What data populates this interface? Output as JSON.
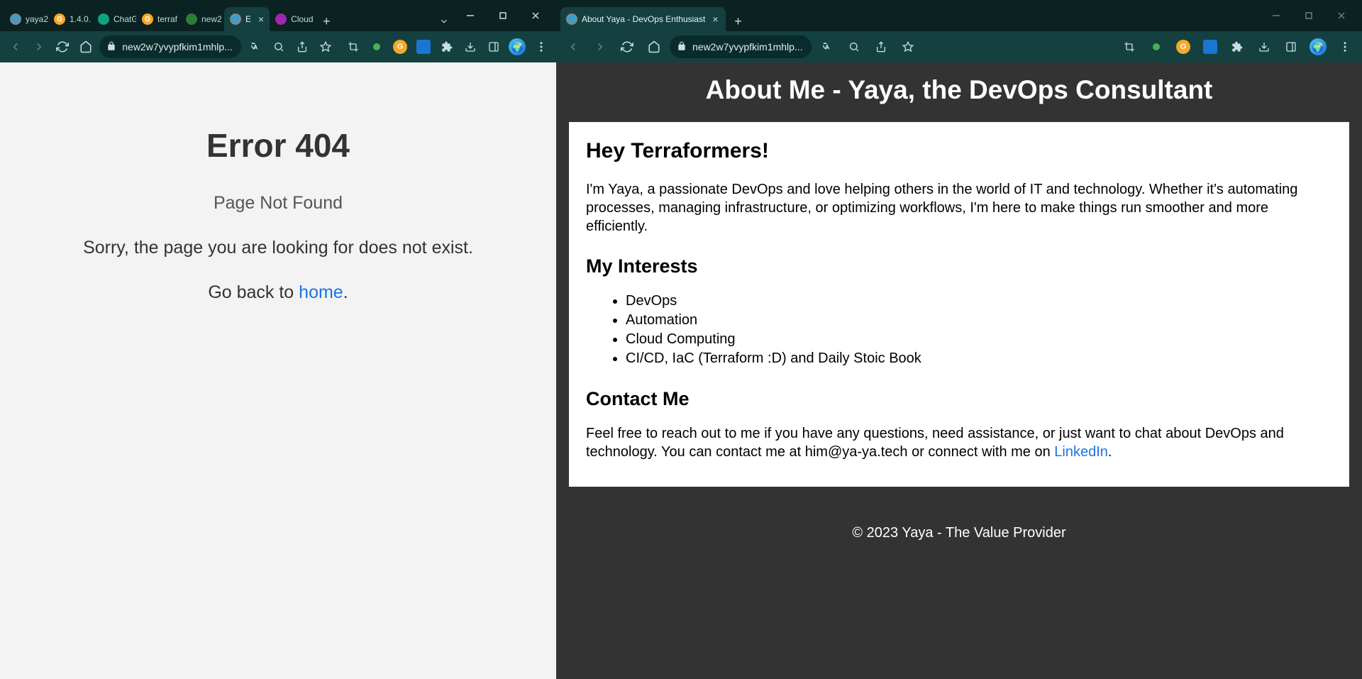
{
  "left": {
    "tabs": [
      {
        "label": "yaya2"
      },
      {
        "label": "1.4.0."
      },
      {
        "label": "ChatG"
      },
      {
        "label": "terraf"
      },
      {
        "label": "new2"
      },
      {
        "label": "E",
        "active": true
      },
      {
        "label": "Cloud"
      }
    ],
    "url": "new2w7yvypfkim1mhlp...",
    "page": {
      "title": "Error 404",
      "subtitle": "Page Not Found",
      "message": "Sorry, the page you are looking for does not exist.",
      "back_prefix": "Go back to ",
      "home_link": "home",
      "back_suffix": "."
    }
  },
  "right": {
    "tabs": [
      {
        "label": "About Yaya - DevOps Enthusiast",
        "active": true
      }
    ],
    "url": "new2w7yvypfkim1mhlp...",
    "page": {
      "header": "About Me - Yaya, the DevOps Consultant",
      "greeting": "Hey Terraformers!",
      "intro": "I'm Yaya, a passionate DevOps and love helping others in the world of IT and technology. Whether it's automating processes, managing infrastructure, or optimizing workflows, I'm here to make things run smoother and more efficiently.",
      "interests_heading": "My Interests",
      "interests": [
        "DevOps",
        "Automation",
        "Cloud Computing",
        "CI/CD, IaC (Terraform :D) and Daily Stoic Book"
      ],
      "contact_heading": "Contact Me",
      "contact_text_pre": "Feel free to reach out to me if you have any questions, need assistance, or just want to chat about DevOps and technology. You can contact me at him@ya-ya.tech or connect with me on ",
      "contact_link": "LinkedIn",
      "contact_text_post": ".",
      "footer": "© 2023 Yaya - The Value Provider"
    }
  }
}
